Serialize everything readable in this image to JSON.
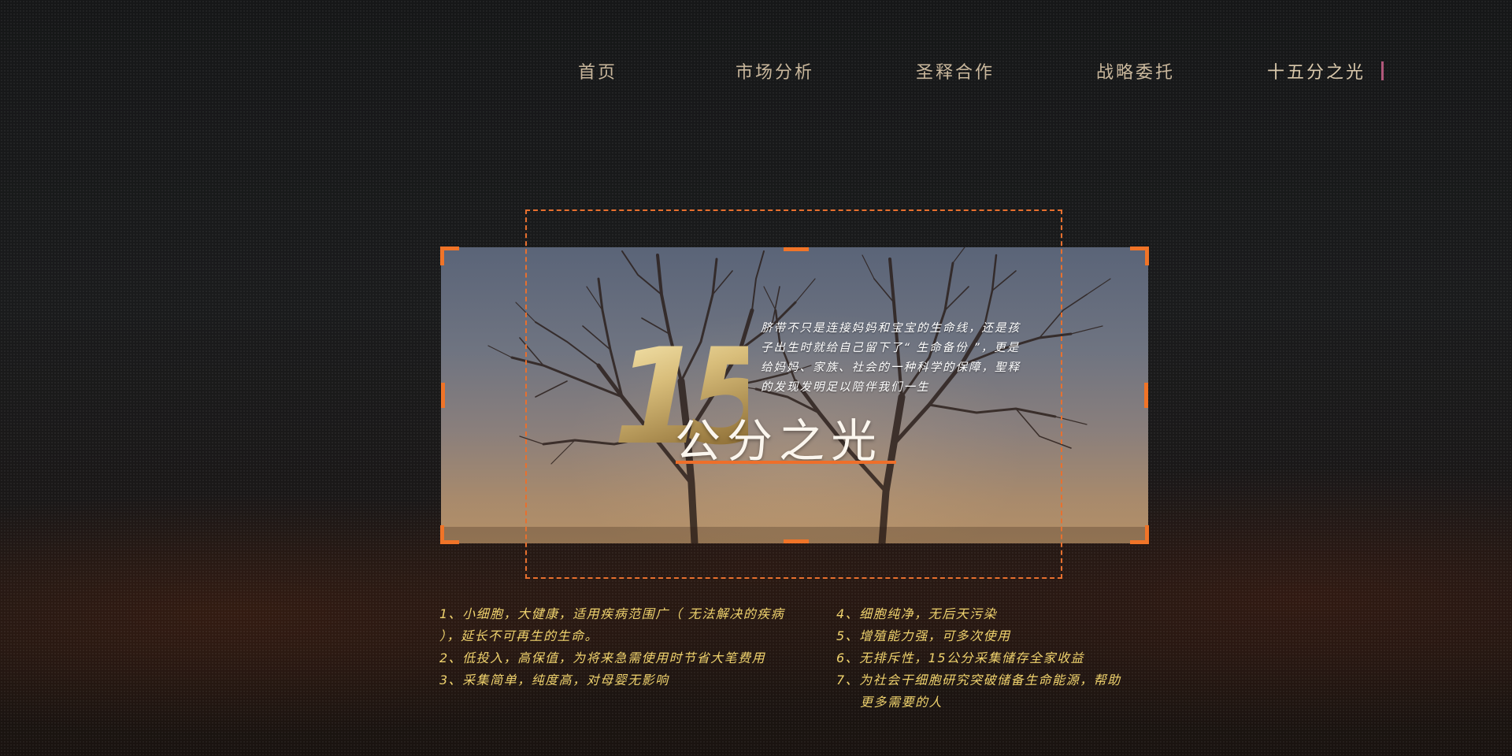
{
  "nav": {
    "items": [
      {
        "label": "首页"
      },
      {
        "label": "市场分析"
      },
      {
        "label": "圣释合作"
      },
      {
        "label": "战略委托"
      },
      {
        "label": "十五分之光"
      }
    ],
    "active_index": 4,
    "active_color": "#b1577a"
  },
  "hero": {
    "number": "15",
    "subtitle": "公分之光",
    "intro": "脐带不只是连接妈妈和宝宝的生命线，还是孩子出生时就给自己留下了“ 生命备份 ”，更是给妈妈、家族、社会的一种科学的保障，聖释的发现发明足以陪伴我们一生",
    "accent_color": "#f07428",
    "number_gradient": [
      "#fff3c0",
      "#c9ab66",
      "#8a6a32"
    ]
  },
  "features": {
    "left": [
      "1、小细胞，大健康，适用疾病范围广（ 无法解决的疾病 ），延长不可再生的生命。",
      "2、低投入，高保值，为将来急需使用时节省大笔费用",
      "3、采集简单，纯度高，对母婴无影响"
    ],
    "right": [
      "4、细胞纯净，无后天污染",
      "5、增殖能力强，可多次使用",
      "6、无排斥性，15公分采集储存全家收益",
      "7、为社会干细胞研究突破储备生命能源，帮助",
      "更多需要的人"
    ],
    "text_color": "#f0d36e"
  }
}
